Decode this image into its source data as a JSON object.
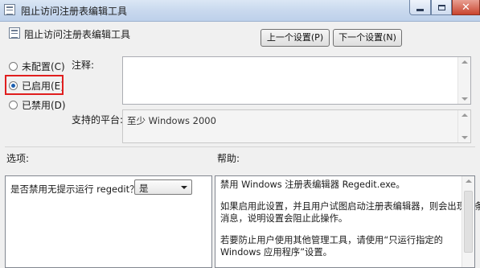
{
  "window": {
    "title": "阻止访问注册表编辑工具"
  },
  "header": {
    "policy_name": "阻止访问注册表编辑工具",
    "prev_button": "上一个设置(P)",
    "next_button": "下一个设置(N)"
  },
  "state": {
    "options": [
      {
        "label": "未配置(C)",
        "checked": false
      },
      {
        "label": "已启用(E)",
        "checked": true
      },
      {
        "label": "已禁用(D)",
        "checked": false
      }
    ]
  },
  "comment": {
    "label": "注释:",
    "value": ""
  },
  "platform": {
    "label": "支持的平台:",
    "value": "至少 Windows 2000"
  },
  "options_section": {
    "label": "选项:",
    "question": "是否禁用无提示运行 regedit？",
    "select_value": "是"
  },
  "help_section": {
    "label": "帮助:",
    "lines": [
      "禁用 Windows 注册表编辑器 Regedit.exe。",
      "如果启用此设置，并且用户试图启动注册表编辑器，则会出现一条",
      "消息，说明设置会阻止此操作。",
      "若要防止用户使用其他管理工具，请使用“只运行指定的",
      "Windows 应用程序”设置。"
    ]
  },
  "colors": {
    "highlight_box": "#e01e1e",
    "radio_dot": "#1c5fb0"
  }
}
